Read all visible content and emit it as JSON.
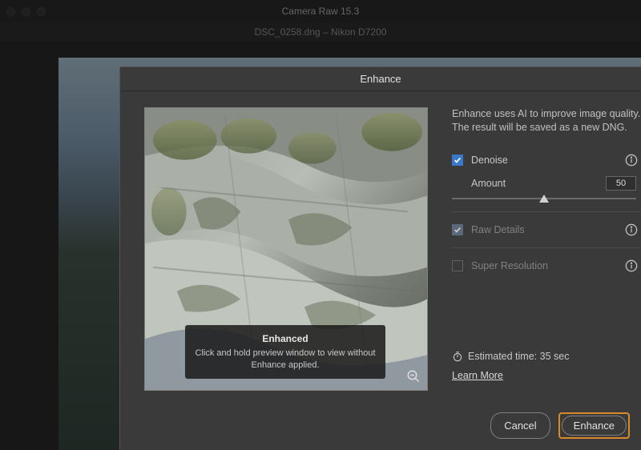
{
  "app": {
    "title": "Camera Raw 15.3",
    "document": "DSC_0258.dng  –  Nikon D7200"
  },
  "dialog": {
    "title": "Enhance",
    "description": "Enhance uses AI to improve image quality. The result will be saved as a new DNG.",
    "preview_overlay": {
      "title": "Enhanced",
      "text": "Click and hold preview window to view without Enhance applied."
    },
    "options": {
      "denoise": {
        "label": "Denoise",
        "checked": true,
        "enabled": true
      },
      "amount": {
        "label": "Amount",
        "value": "50",
        "percent": 50
      },
      "raw_details": {
        "label": "Raw Details",
        "checked": true,
        "enabled": false
      },
      "super_resolution": {
        "label": "Super Resolution",
        "checked": false,
        "enabled": false
      }
    },
    "footer": {
      "estimated": "Estimated time: 35 sec",
      "learn_more": "Learn More"
    },
    "buttons": {
      "cancel": "Cancel",
      "enhance": "Enhance"
    }
  }
}
